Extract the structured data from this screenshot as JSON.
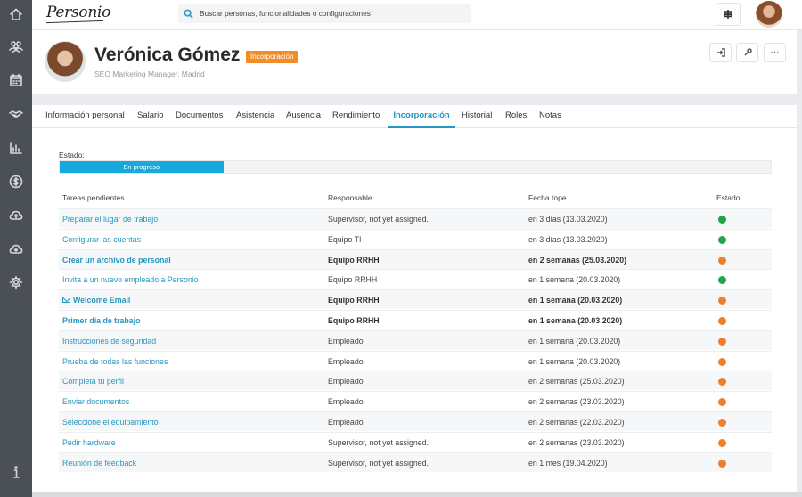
{
  "app": {
    "logo": "Personio"
  },
  "search": {
    "placeholder": "Buscar personas, funcionalidades o configuraciones"
  },
  "employee": {
    "name": "Verónica Gómez",
    "badge": "Incorporación",
    "subtitle": "SEO Marketing Manager, Madrid"
  },
  "tabs": [
    {
      "label": "Información personal",
      "active": false
    },
    {
      "label": "Salario",
      "active": false
    },
    {
      "label": "Documentos",
      "active": false
    },
    {
      "label": "Asistencia",
      "active": false
    },
    {
      "label": "Ausencia",
      "active": false
    },
    {
      "label": "Rendimiento",
      "active": false
    },
    {
      "label": "Incorporación",
      "active": true
    },
    {
      "label": "Historial",
      "active": false
    },
    {
      "label": "Roles",
      "active": false
    },
    {
      "label": "Notas",
      "active": false
    }
  ],
  "status": {
    "label": "Estado:",
    "value": "En progreso",
    "progress": 0.23
  },
  "table": {
    "headers": {
      "task": "Tareas pendientes",
      "owner": "Responsable",
      "due": "Fecha tope",
      "state": "Estado"
    },
    "rows": [
      {
        "task": "Preparar el lugar de trabajo",
        "owner": "Supervisor, not yet assigned.",
        "due": "en 3 días (13.03.2020)",
        "state": "green",
        "bold": false
      },
      {
        "task": "Configurar las cuentas",
        "owner": "Equipo TI",
        "due": "en 3 días (13.03.2020)",
        "state": "green",
        "bold": false
      },
      {
        "task": "Crear un archivo de personal",
        "owner": "Equipo RRHH",
        "due": "en 2 semanas (25.03.2020)",
        "state": "orange",
        "bold": true
      },
      {
        "task": "Invita a un nuevo empleado a Personio",
        "owner": "Equipo RRHH",
        "due": "en 1 semana (20.03.2020)",
        "state": "green",
        "bold": false
      },
      {
        "task": "Welcome Email",
        "owner": "Equipo RRHH",
        "due": "en 1 semana (20.03.2020)",
        "state": "orange",
        "bold": true,
        "icon": "mail-icon"
      },
      {
        "task": "Primer día de trabajo",
        "owner": "Equipo RRHH",
        "due": "en 1 semana (20.03.2020)",
        "state": "orange",
        "bold": true
      },
      {
        "task": "Instrucciones de seguridad",
        "owner": "Empleado",
        "due": "en 1 semana (20.03.2020)",
        "state": "orange",
        "bold": false
      },
      {
        "task": "Prueba de todas las funciones",
        "owner": "Empleado",
        "due": "en 1 semana (20.03.2020)",
        "state": "orange",
        "bold": false
      },
      {
        "task": "Completa tu perfil",
        "owner": "Empleado",
        "due": "en 2 semanas (25.03.2020)",
        "state": "orange",
        "bold": false
      },
      {
        "task": "Enviar documentos",
        "owner": "Empleado",
        "due": "en 2 semanas (23.03.2020)",
        "state": "orange",
        "bold": false
      },
      {
        "task": "Seleccione el equipamiento",
        "owner": "Empleado",
        "due": "en 2 semanas (22.03.2020)",
        "state": "orange",
        "bold": false
      },
      {
        "task": "Pedir hardware",
        "owner": "Supervisor, not yet assigned.",
        "due": "en 2 semanas (23.03.2020)",
        "state": "orange",
        "bold": false
      },
      {
        "task": "Reunión de feedback",
        "owner": "Supervisor, not yet assigned.",
        "due": "en 1 mes (19.04.2020)",
        "state": "orange",
        "bold": false
      }
    ]
  },
  "colors": {
    "green": "#21a44c",
    "orange": "#ee7f2d",
    "accent": "#2697c0",
    "progress": "#17a9dc"
  }
}
